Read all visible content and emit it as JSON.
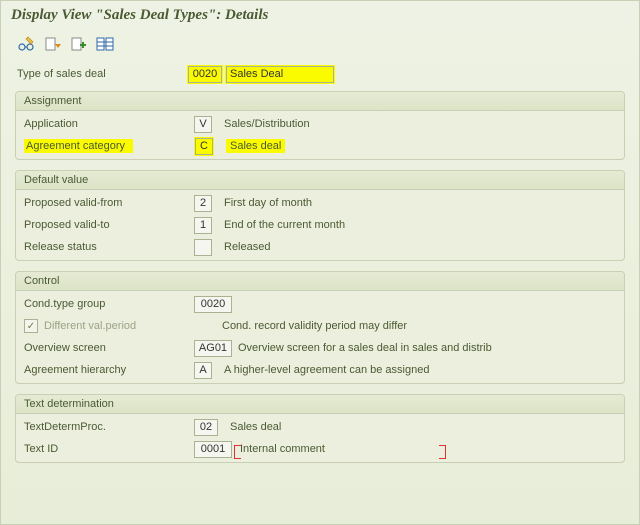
{
  "title": "Display View \"Sales Deal Types\": Details",
  "icons": {
    "edit": "edit-icon",
    "doc_next": "doc-next-icon",
    "doc_add": "doc-add-icon",
    "compare": "compare-icon"
  },
  "header": {
    "type_of_sales_deal_label": "Type of sales deal",
    "type_of_sales_deal_value": "0020",
    "type_of_sales_deal_desc": "Sales Deal"
  },
  "panels": {
    "assignment": {
      "title": "Assignment",
      "application_label": "Application",
      "application_value": "V",
      "application_desc": "Sales/Distribution",
      "agreement_cat_label": "Agreement category",
      "agreement_cat_value": "C",
      "agreement_cat_desc": "Sales deal"
    },
    "default": {
      "title": "Default value",
      "valid_from_label": "Proposed valid-from",
      "valid_from_value": "2",
      "valid_from_desc": "First day of month",
      "valid_to_label": "Proposed valid-to",
      "valid_to_value": "1",
      "valid_to_desc": "End of the current month",
      "release_label": "Release status",
      "release_value": "",
      "release_desc": "Released"
    },
    "control": {
      "title": "Control",
      "ctg_label": "Cond.type group",
      "ctg_value": "0020",
      "diff_label": "Different val.period",
      "diff_desc": "Cond. record validity period may differ",
      "ov_label": "Overview screen",
      "ov_value": "AG01",
      "ov_desc": "Overview screen for a sales deal in sales and distrib",
      "ah_label": "Agreement hierarchy",
      "ah_value": "A",
      "ah_desc": "A higher-level agreement can be assigned"
    },
    "text": {
      "title": "Text determination",
      "tdp_label": "TextDetermProc.",
      "tdp_value": "02",
      "tdp_desc": "Sales deal",
      "tid_label": "Text ID",
      "tid_value": "0001",
      "tid_desc": "Internal comment"
    }
  }
}
